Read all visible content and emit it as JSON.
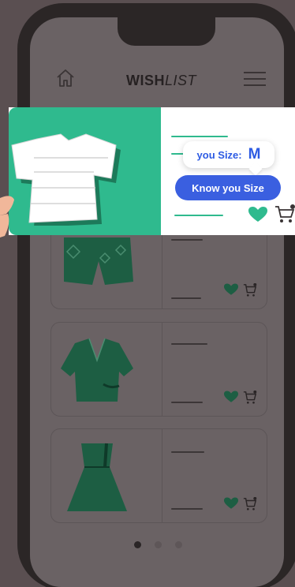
{
  "header": {
    "title_bold": "WISH",
    "title_italic": "LIST"
  },
  "featured": {
    "size_label": "you Size:",
    "size_value": "M",
    "know_size_button": "Know you Size"
  },
  "pager": {
    "count": 3,
    "active": 0
  },
  "colors": {
    "accent_green": "#2fba8e",
    "accent_blue": "#3a5fe0",
    "overlay": "#5a4f51"
  },
  "icons": [
    "home-icon",
    "menu-icon",
    "heart-icon",
    "cart-icon"
  ]
}
